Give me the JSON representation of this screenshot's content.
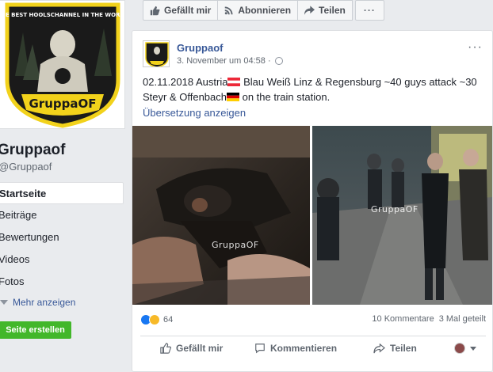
{
  "page": {
    "name": "Gruppaof",
    "handle": "@Gruppaof",
    "cover_text_top": "THE BEST HOOLSCHANNEL IN THE WORLD",
    "cover_text_bottom": "GruppaOF"
  },
  "nav": {
    "items": [
      {
        "label": "Startseite",
        "active": true
      },
      {
        "label": "Beiträge",
        "active": false
      },
      {
        "label": "Bewertungen",
        "active": false
      },
      {
        "label": "Videos",
        "active": false
      },
      {
        "label": "Fotos",
        "active": false
      }
    ],
    "more_label": "Mehr anzeigen",
    "create_page_label": "Seite erstellen"
  },
  "topbar": {
    "like_label": "Gefällt mir",
    "follow_label": "Abonnieren",
    "share_label": "Teilen",
    "more_label": "···"
  },
  "post": {
    "author": "Gruppaof",
    "timestamp": "3. November um 04:58 ·",
    "text_line1_a": "02.11.2018 Austria",
    "text_line1_b": " Blau Weiß Linz & Regensburg ~40 guys attack ~30",
    "text_line2_a": "Steyr & Offenbach",
    "text_line2_b": " on the train station.",
    "translate_label": "Übersetzung anzeigen",
    "watermark": "GruppaOF",
    "menu_label": "···",
    "reaction_count": "64",
    "comments_label": "10 Kommentare",
    "shares_label": "3 Mal geteilt"
  },
  "actions": {
    "like_label": "Gefällt mir",
    "comment_label": "Kommentieren",
    "share_label": "Teilen"
  },
  "colors": {
    "link": "#385898",
    "create_button": "#42b72a",
    "background": "#e9ebee"
  },
  "icons": [
    "like-icon",
    "rss-icon",
    "share-icon",
    "globe-icon",
    "haha-icon",
    "comment-icon",
    "chevron-down-icon"
  ]
}
